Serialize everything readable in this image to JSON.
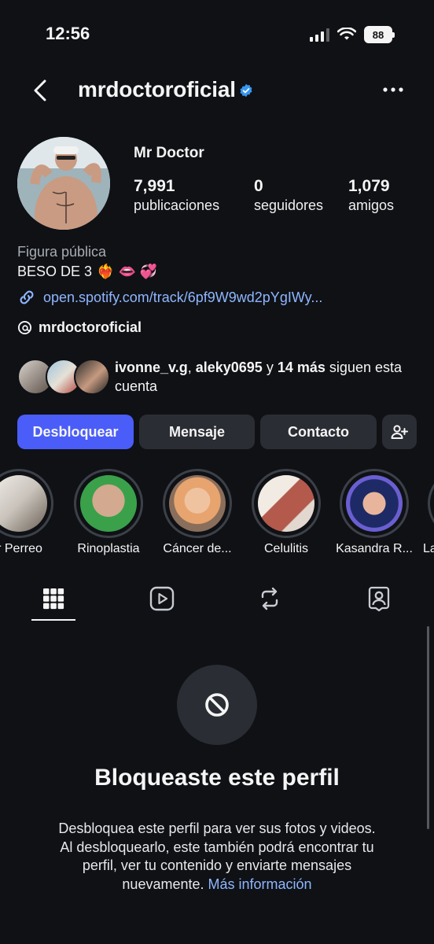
{
  "status_bar": {
    "time": "12:56",
    "battery": "88"
  },
  "header": {
    "username": "mrdoctoroficial"
  },
  "profile": {
    "display_name": "Mr Doctor",
    "stats": [
      {
        "value": "7,991",
        "label": "publicaciones"
      },
      {
        "value": "0",
        "label": "seguidores"
      },
      {
        "value": "1,079",
        "label": "amigos"
      }
    ],
    "category": "Figura pública",
    "bio": "BESO DE 3",
    "bio_emojis": "❤️‍🔥 👄 💞",
    "link": "open.spotify.com/track/6pf9W9wd2pYgIWy...",
    "threads_username": "mrdoctoroficial",
    "followed_by": {
      "user1": "ivonne_v.g",
      "user2": "aleky0695",
      "and": "y",
      "more": "14 más",
      "suffix": "siguen esta cuenta"
    }
  },
  "actions": {
    "unblock": "Desbloquear",
    "message": "Mensaje",
    "contact": "Contacto"
  },
  "highlights": [
    {
      "label": "r Perreo"
    },
    {
      "label": "Rinoplastia"
    },
    {
      "label": "Cáncer de..."
    },
    {
      "label": "Celulitis"
    },
    {
      "label": "Kasandra R..."
    },
    {
      "label": "La"
    }
  ],
  "tabs": [
    "grid-icon",
    "reels-icon",
    "reposts-icon",
    "tagged-icon"
  ],
  "blocked": {
    "title": "Bloqueaste este perfil",
    "description": "Desbloquea este perfil para ver sus fotos y videos. Al desbloquearlo, este también podrá encontrar tu perfil, ver tu contenido y enviarte mensajes nuevamente.",
    "more_link": "Más información"
  },
  "colors": {
    "background": "#0f1115",
    "primary_button": "#4a5df9",
    "link": "#8fb6ff",
    "verified": "#3897f0"
  }
}
